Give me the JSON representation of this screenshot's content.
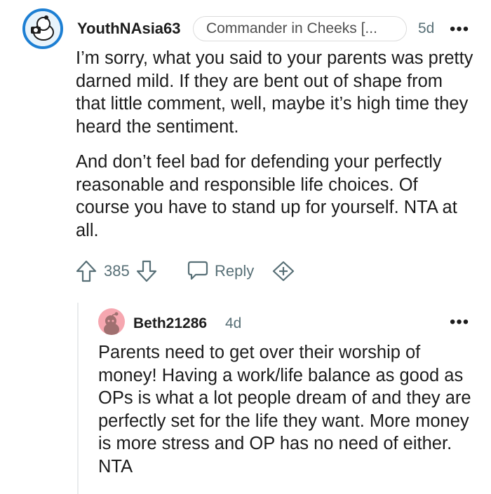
{
  "comment": {
    "username": "YouthNAsia63",
    "flair": "Commander in Cheeks [...",
    "time": "5d",
    "paragraphs": [
      "I’m sorry, what you said to your parents was pretty darned mild. If they are bent out of shape from that little comment, well, maybe it’s high time they heard the sentiment.",
      "And don’t feel bad for defending your perfectly reasonable and responsible life choices. Of course you have to stand up for yourself. NTA at all."
    ],
    "score": "385",
    "reply_label": "Reply"
  },
  "reply": {
    "username": "Beth21286",
    "time": "4d",
    "text": "Parents need to get over their worship of money! Having a work/life balance as good as OPs is what a lot people dream of and they are perfectly set for the life they want. More money is more stress and OP has no need of either. NTA"
  },
  "more_label": "•••",
  "colors": {
    "avatar_ring": "#1d7fd3",
    "reply_avatar": "#f6a7b0",
    "muted": "#576f76"
  }
}
